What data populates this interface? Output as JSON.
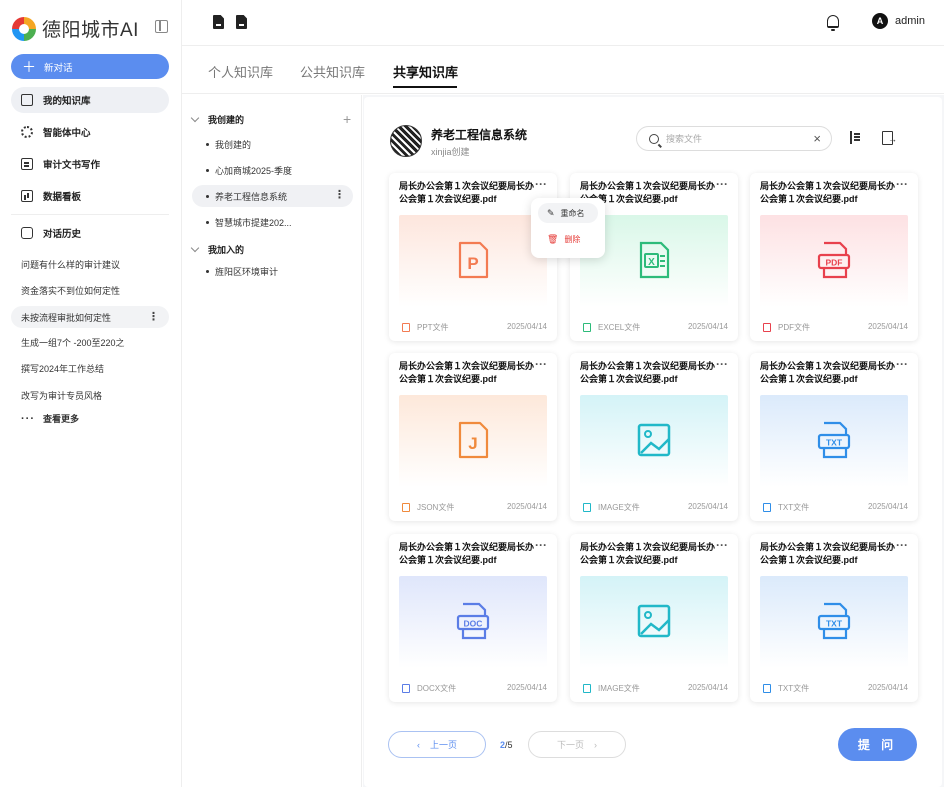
{
  "app": {
    "title": "德阳城市AI"
  },
  "sidebar": {
    "new_chat_label": "新对话",
    "nav": [
      {
        "label": "我的知识库",
        "icon": "book-icon",
        "active": true
      },
      {
        "label": "智能体中心",
        "icon": "gear-icon",
        "active": false
      },
      {
        "label": "审计文书写作",
        "icon": "edit-doc-icon",
        "active": false
      },
      {
        "label": "数据看板",
        "icon": "chart-icon",
        "active": false
      }
    ],
    "history_label": "对话历史",
    "history": [
      "问题有什么样的审计建议",
      "资金落实不到位如何定性",
      "未按流程审批如何定性",
      "生成一组7个 -200至220之",
      "撰写2024年工作总结",
      "改写为审计专员风格"
    ],
    "see_more": "查看更多"
  },
  "header": {
    "user_initial": "A",
    "user_name": "admin"
  },
  "tabs": [
    "个人知识库",
    "公共知识库",
    "共享知识库"
  ],
  "tree": {
    "groups": [
      {
        "label": "我创建的",
        "items": [
          "我创建的",
          "心加商城2025-季度",
          "养老工程信息系统",
          "智慧城市提建202..."
        ]
      },
      {
        "label": "我加入的",
        "items": [
          "旌阳区环境审计"
        ]
      }
    ]
  },
  "kb": {
    "title": "养老工程信息系统",
    "subtitle": "xinjia创建",
    "search_placeholder": "搜索文件"
  },
  "menu": {
    "rename": "重命名",
    "delete": "删除"
  },
  "files": [
    {
      "title": "局长办公会第１次会议纪要局长办公会第１次会议纪要.pdf",
      "type": "PPT文件",
      "date": "2025/04/14",
      "kind": "ppt",
      "color": "#f37b52",
      "bg": "linear-gradient(#fde6dd,#fff)",
      "glyph": "P"
    },
    {
      "title": "局长办公会第１次会议纪要局长办公会第１次会议纪要.pdf",
      "type": "EXCEL文件",
      "date": "2025/04/14",
      "kind": "excel",
      "color": "#2dbb7a",
      "bg": "linear-gradient(#d9f7e8,#fff)",
      "glyph": "X"
    },
    {
      "title": "局长办公会第１次会议纪要局长办公会第１次会议纪要.pdf",
      "type": "PDF文件",
      "date": "2025/04/14",
      "kind": "pdf",
      "color": "#e8414d",
      "bg": "linear-gradient(#fde1e3,#fff)",
      "glyph": "PDF"
    },
    {
      "title": "局长办公会第１次会议纪要局长办公会第１次会议纪要.pdf",
      "type": "JSON文件",
      "date": "2025/04/14",
      "kind": "json",
      "color": "#f08a3c",
      "bg": "linear-gradient(#fde8da,#fff)",
      "glyph": "J"
    },
    {
      "title": "局长办公会第１次会议纪要局长办公会第１次会议纪要.pdf",
      "type": "IMAGE文件",
      "date": "2025/04/14",
      "kind": "image",
      "color": "#21b8c8",
      "bg": "linear-gradient(#d4f3f7,#fff)",
      "glyph": ""
    },
    {
      "title": "局长办公会第１次会议纪要局长办公会第１次会议纪要.pdf",
      "type": "TXT文件",
      "date": "2025/04/14",
      "kind": "txt",
      "color": "#2f8ee8",
      "bg": "linear-gradient(#dbeafb,#fff)",
      "glyph": "TXT"
    },
    {
      "title": "局长办公会第１次会议纪要局长办公会第１次会议纪要.pdf",
      "type": "DOCX文件",
      "date": "2025/04/14",
      "kind": "docx",
      "color": "#5b7de6",
      "bg": "linear-gradient(#dfe6fb,#fff)",
      "glyph": "DOC"
    },
    {
      "title": "局长办公会第１次会议纪要局长办公会第１次会议纪要.pdf",
      "type": "IMAGE文件",
      "date": "2025/04/14",
      "kind": "image",
      "color": "#21b8c8",
      "bg": "linear-gradient(#d4f3f7,#fff)",
      "glyph": ""
    },
    {
      "title": "局长办公会第１次会议纪要局长办公会第１次会议纪要.pdf",
      "type": "TXT文件",
      "date": "2025/04/14",
      "kind": "txt",
      "color": "#2f8ee8",
      "bg": "linear-gradient(#dbeafb,#fff)",
      "glyph": "TXT"
    }
  ],
  "pagination": {
    "prev": "上一页",
    "current": "2",
    "total": "/5",
    "next": "下一页"
  },
  "submit_label": "提 问",
  "colors": {
    "accent": "#5b8def",
    "danger": "#e53935"
  }
}
